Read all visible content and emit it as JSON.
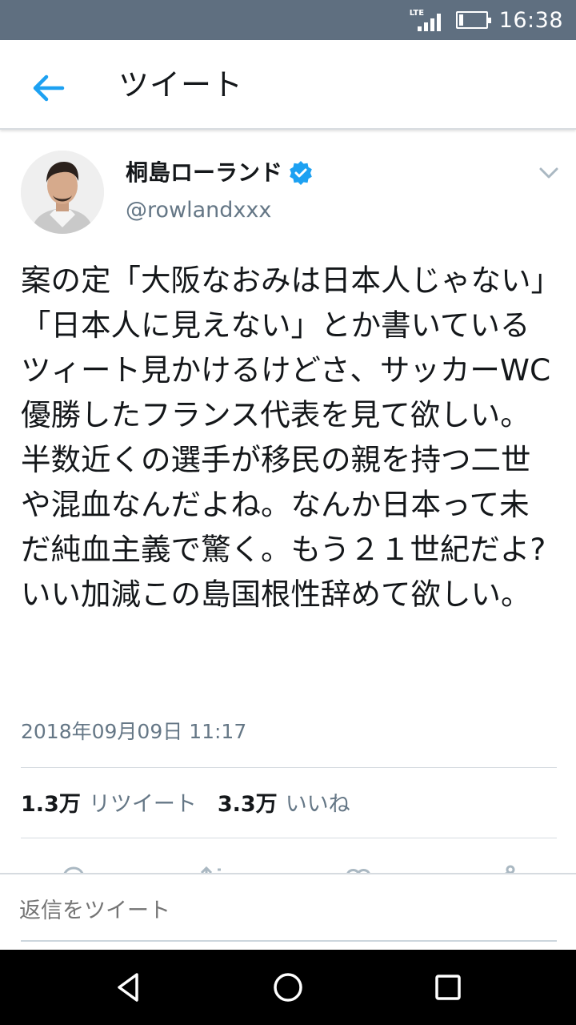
{
  "status_bar": {
    "network": "LTE",
    "time": "16:38",
    "battery_level": 0.15
  },
  "app_bar": {
    "back_icon": "arrow-left-icon",
    "title": "ツイート"
  },
  "tweet": {
    "author_name": "桐島ローランド",
    "author_handle": "@rowlandxxx",
    "verified": true,
    "text": "案の定「大阪なおみは日本人じゃない」「日本人に見えない」とか書いているツィート見かけるけどさ、サッカーWC優勝したフランス代表を見て欲しい。半数近くの選手が移民の親を持つ二世や混血なんだよね。なんか日本って未だ純血主義で驚く。もう２１世紀だよ?いい加減この島国根性辞めて欲しい。",
    "timestamp": "2018年09月09日 11:17",
    "retweet_count": "1.3万",
    "retweet_label": "リツイート",
    "like_count": "3.3万",
    "like_label": "いいね"
  },
  "actions": [
    "reply-icon",
    "retweet-icon",
    "like-icon",
    "share-icon"
  ],
  "reply_bar": {
    "placeholder": "返信をツイート"
  },
  "nav_bar": [
    "back-triangle-icon",
    "home-circle-icon",
    "recents-square-icon"
  ],
  "colors": {
    "status_bar": "#5f6f80",
    "accent_blue": "#1da1f2",
    "secondary_text": "#657786",
    "divider": "#d6dbe0"
  }
}
